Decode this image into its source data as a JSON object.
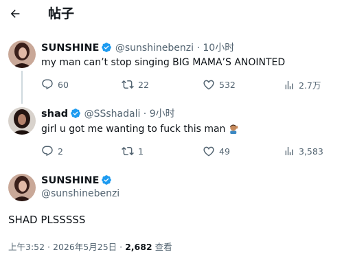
{
  "header": {
    "title": "帖子"
  },
  "colors": {
    "accent": "#1d9bf0",
    "muted": "#536471",
    "text": "#0f1419",
    "line": "#cfd9de"
  },
  "tweets": [
    {
      "name": "SUNSHINE",
      "handle": "@sunshinebenzi",
      "time": "· 10小时",
      "text": "my man can’t stop singing BIG MAMA’S ANOINTED",
      "replies": "60",
      "retweets": "22",
      "likes": "532",
      "views": "2.7万"
    },
    {
      "name": "shad",
      "handle": "@SSshadali",
      "time": "· 9小时",
      "text": "girl u got me wanting to fuck this man",
      "emoji_icon": "facepalm-emoji-icon",
      "replies": "2",
      "retweets": "1",
      "likes": "49",
      "views": "3,583"
    }
  ],
  "main_post": {
    "name": "SUNSHINE",
    "handle": "@sunshinebenzi",
    "text": "SHAD PLSSSSS",
    "timestamp": "上午3:52 · 2026年5月25日 ·",
    "views_count": "2,682",
    "views_label": "查看"
  },
  "icons": [
    "back-arrow-icon",
    "verified-badge-icon",
    "reply-icon",
    "retweet-icon",
    "like-icon",
    "views-icon"
  ]
}
